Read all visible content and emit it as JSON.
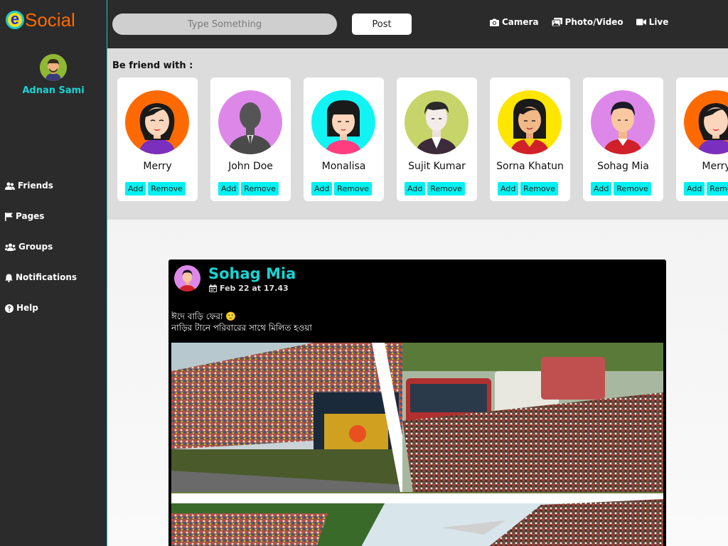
{
  "app": {
    "logo_letter": "e",
    "logo_text": "Social"
  },
  "user": {
    "name": "Adnan Sami"
  },
  "sidebar": {
    "items": [
      {
        "label": "Friends",
        "icon": "users-icon"
      },
      {
        "label": "Pages",
        "icon": "flag-icon"
      },
      {
        "label": "Groups",
        "icon": "group-icon"
      },
      {
        "label": "Notifications",
        "icon": "bell-icon"
      },
      {
        "label": "Help",
        "icon": "help-icon"
      }
    ]
  },
  "topbar": {
    "search_placeholder": "Type Something",
    "post_label": "Post",
    "actions": [
      {
        "label": "Camera",
        "icon": "camera-icon"
      },
      {
        "label": "Photo/Video",
        "icon": "images-icon"
      },
      {
        "label": "Live",
        "icon": "video-icon"
      }
    ]
  },
  "suggestions": {
    "title": "Be friend with :",
    "add_label": "Add",
    "remove_label": "Remove",
    "people": [
      {
        "name": "Merry",
        "bg": "#ff6a00"
      },
      {
        "name": "John Doe",
        "bg": "#dd88e8"
      },
      {
        "name": "Monalisa",
        "bg": "#12f4f4"
      },
      {
        "name": "Sujit Kumar",
        "bg": "#c6d46a"
      },
      {
        "name": "Sorna Khatun",
        "bg": "#ffe600"
      },
      {
        "name": "Sohag Mia",
        "bg": "#dd88e8"
      },
      {
        "name": "Merry",
        "bg": "#ff6a00"
      }
    ]
  },
  "post": {
    "author": "Sohag Mia",
    "date": "Feb 22 at 17.43",
    "text_line1": "ঈদে বাড়ি ফেরা 🙂",
    "text_line2": "নাড়ির টানে পরিবারের সাথে মিলিত হওয়া"
  },
  "colors": {
    "accent": "#18d4d4",
    "button": "#00f2f2",
    "dark": "#2b2b2b",
    "logo_orange": "#ff6a00"
  }
}
